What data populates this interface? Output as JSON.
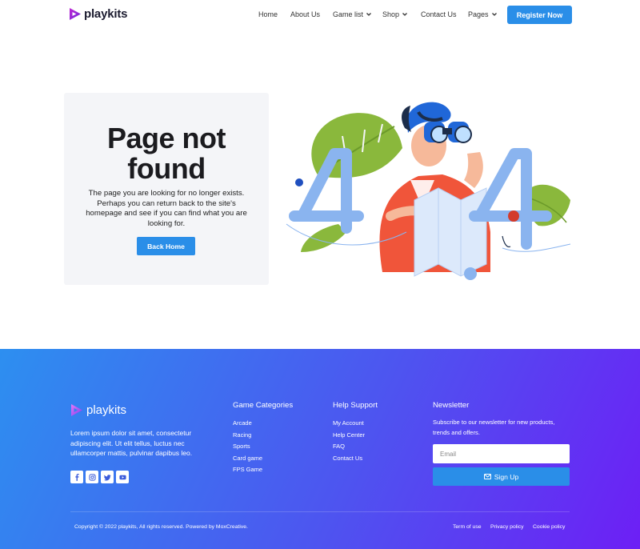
{
  "brand": {
    "name": "playkits"
  },
  "nav": {
    "items": [
      {
        "label": "Home",
        "dropdown": false
      },
      {
        "label": "About Us",
        "dropdown": false
      },
      {
        "label": "Game list",
        "dropdown": true
      },
      {
        "label": "Shop",
        "dropdown": true
      },
      {
        "label": "Contact Us",
        "dropdown": false
      },
      {
        "label": "Pages",
        "dropdown": true
      }
    ],
    "cta_label": "Register Now"
  },
  "not_found": {
    "title_line1": "Page not",
    "title_line2": "found",
    "message": "The page you are looking for no longer exists. Perhaps you can return back to the site's homepage and see if you can find what you are looking for.",
    "button_label": "Back Home",
    "illustration_icon": "404-binoculars-illustration"
  },
  "footer": {
    "about_text": "Lorem ipsum dolor sit amet, consectetur adipiscing elit. Ut elit tellus, luctus nec ullamcorper mattis, pulvinar dapibus leo.",
    "socials": [
      "facebook-icon",
      "instagram-icon",
      "twitter-icon",
      "youtube-icon"
    ],
    "game_categories": {
      "title": "Game Categories",
      "links": [
        "Arcade",
        "Racing",
        "Sports",
        "Card game",
        "FPS Game"
      ]
    },
    "help_support": {
      "title": "Help Support",
      "links": [
        "My Account",
        "Help Center",
        "FAQ",
        "Contact Us"
      ]
    },
    "newsletter": {
      "title": "Newsletter",
      "text": "Subscribe to our newsletter for new products, trends and offers.",
      "email_placeholder": "Email",
      "button_label": "Sign Up"
    },
    "copyright": "Copyright © 2022 playkits, All rights reserved. Powered by MoxCreative.",
    "legal_links": [
      "Term of use",
      "Privacy policy",
      "Cookie policy"
    ]
  },
  "colors": {
    "accent": "#2a8ee8",
    "brand_purple": "#8a2be2",
    "footer_gradient_start": "#2d8ff0",
    "footer_gradient_end": "#6d1ff5"
  }
}
